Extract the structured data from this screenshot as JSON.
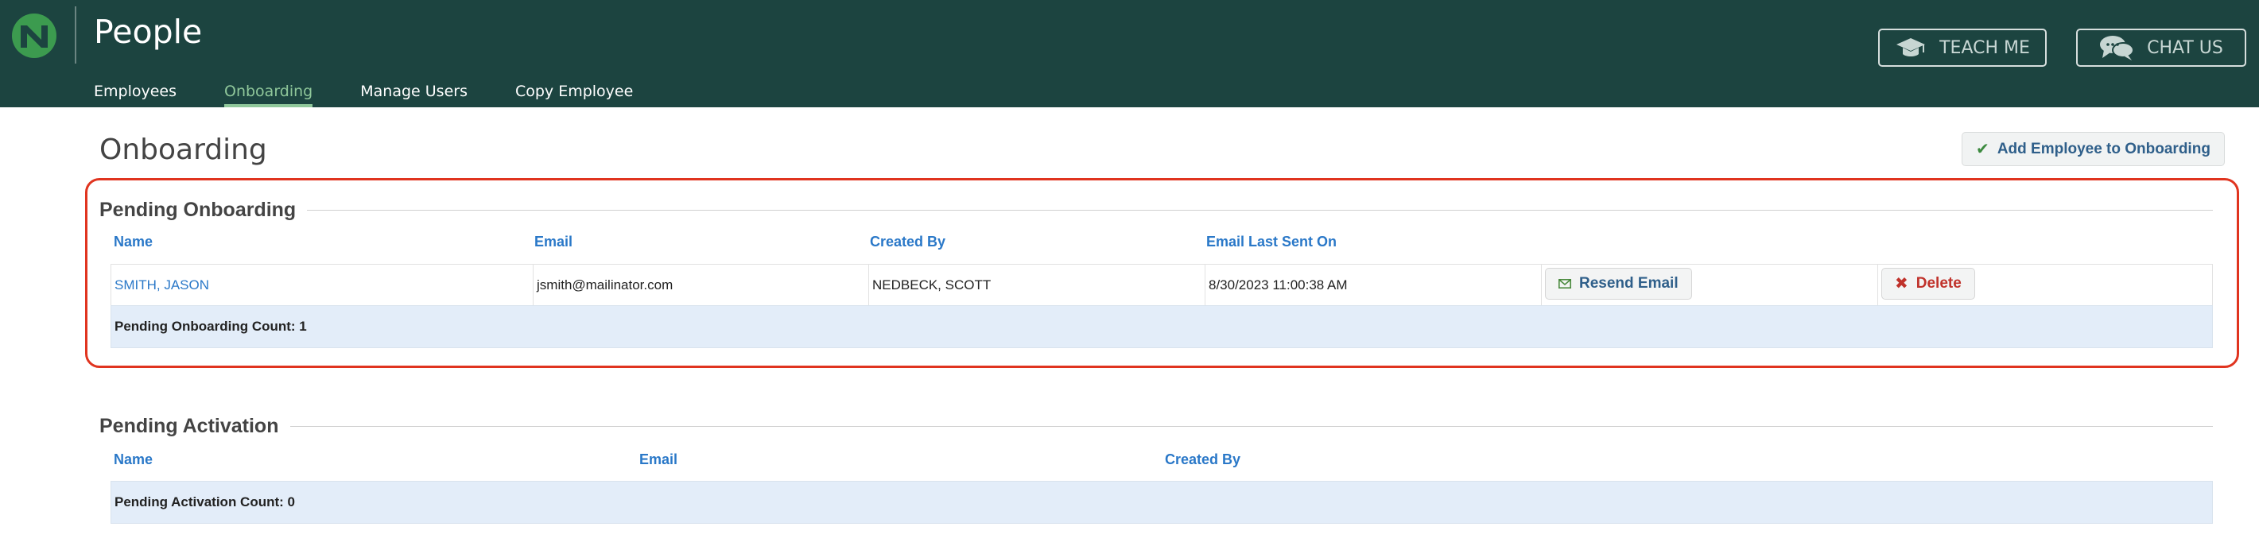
{
  "header": {
    "app_title": "People",
    "nav": [
      {
        "label": "Employees",
        "active": false
      },
      {
        "label": "Onboarding",
        "active": true
      },
      {
        "label": "Manage Users",
        "active": false
      },
      {
        "label": "Copy Employee",
        "active": false
      }
    ],
    "teach_me_label": "TEACH ME",
    "chat_us_label": "CHAT US"
  },
  "page": {
    "title": "Onboarding",
    "add_button_label": "Add Employee to Onboarding"
  },
  "pending_onboarding": {
    "title": "Pending Onboarding",
    "columns": [
      "Name",
      "Email",
      "Created By",
      "Email Last Sent On"
    ],
    "rows": [
      {
        "name": "SMITH, JASON",
        "email": "jsmith@mailinator.com",
        "created_by": "NEDBECK, SCOTT",
        "email_last_sent_on": "8/30/2023 11:00:38 AM",
        "resend_label": "Resend Email",
        "delete_label": "Delete"
      }
    ],
    "count_label": "Pending Onboarding Count: 1"
  },
  "pending_activation": {
    "title": "Pending Activation",
    "columns": [
      "Name",
      "Email",
      "Created By"
    ],
    "count_label": "Pending Activation Count: 0"
  },
  "colors": {
    "header_bg": "#1c4440",
    "active_nav": "#8fc79a",
    "link": "#2a78c8",
    "highlight": "#e0341f",
    "count_row_bg": "#e3edf9"
  },
  "icons": {
    "logo": "brand-logo-icon",
    "teach": "graduation-cap-icon",
    "chat": "chat-bubbles-icon",
    "add": "checkmark-icon",
    "resend": "envelope-icon",
    "delete": "x-icon"
  }
}
